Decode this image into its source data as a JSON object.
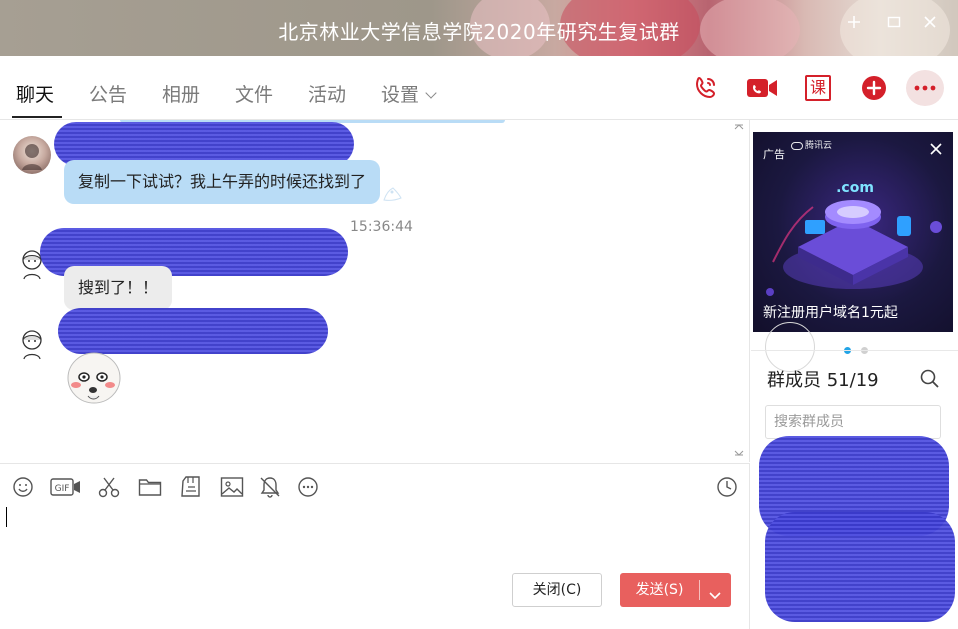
{
  "window": {
    "title": "北京林业大学信息学院2020年研究生复试群"
  },
  "tabs": [
    {
      "label": "聊天"
    },
    {
      "label": "公告"
    },
    {
      "label": "相册"
    },
    {
      "label": "文件"
    },
    {
      "label": "活动"
    },
    {
      "label": "设置"
    }
  ],
  "header_actions": {
    "course_label": "课"
  },
  "chat": {
    "messages": [
      {
        "sender": "hidden",
        "text": "复制一下试试？我上午弄的时候还找到了"
      },
      {
        "timestamp": "15:36:44"
      },
      {
        "sender": "hidden",
        "text": "搜到了！！"
      },
      {
        "sender": "hidden",
        "type": "sticker"
      }
    ]
  },
  "composer": {
    "gif_label": "GIF",
    "close_button": "关闭(C)",
    "send_button": "发送(S)"
  },
  "sidebar": {
    "ad": {
      "tag": "广告",
      "brand": "腾讯云",
      "graphic_text": ".com",
      "caption": "新注册用户域名1元起",
      "slides": 2,
      "active_slide": 1
    },
    "members_title": "群成员 51/19",
    "members_search_placeholder": "搜索群成员"
  },
  "colors": {
    "accent_red": "#e8605e",
    "icon_red": "#d4202a",
    "bubble_blue": "#b9dcf6",
    "bubble_gray": "#ececec",
    "redaction_blue": "#3838c8",
    "dot_active": "#22a4e6"
  }
}
